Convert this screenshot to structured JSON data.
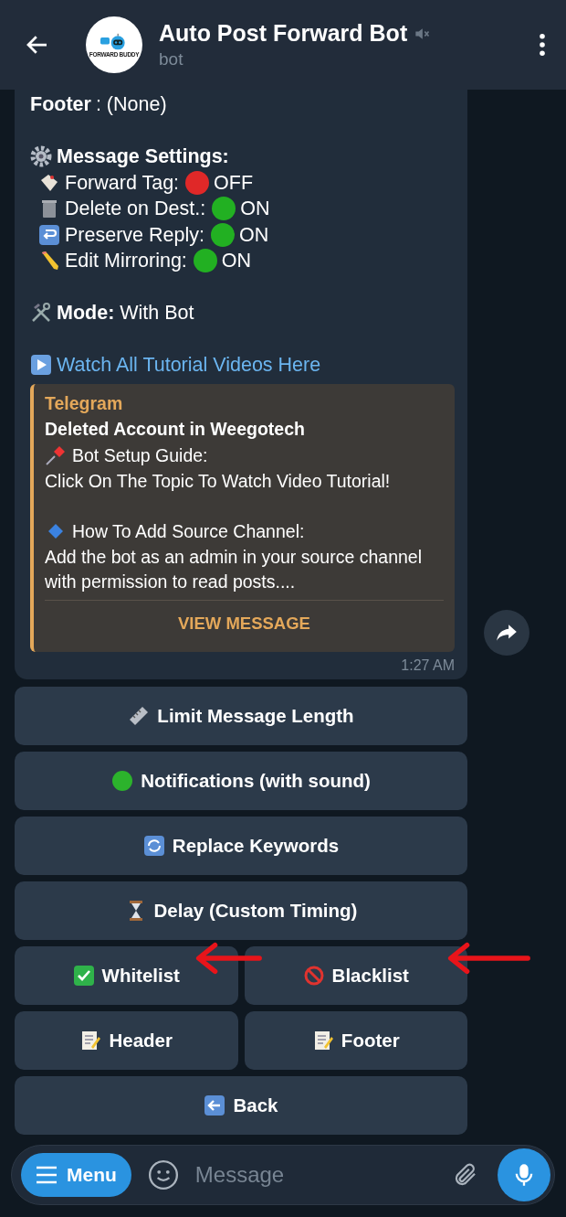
{
  "header": {
    "title": "Auto Post Forward Bot",
    "subtitle": "bot",
    "muted": true,
    "avatar_text": "FORWARD BUDDY"
  },
  "message": {
    "footer_line": "**Footer** : (None)",
    "settings_title": "Message Settings:",
    "settings": [
      {
        "kind": "tag",
        "label": "Forward Tag:",
        "on": false,
        "state": "OFF"
      },
      {
        "kind": "trash",
        "label": "Delete on Dest.:",
        "on": true,
        "state": "ON"
      },
      {
        "kind": "reply",
        "label": "Preserve Reply:",
        "on": true,
        "state": "ON"
      },
      {
        "kind": "pencil",
        "label": "Edit Mirroring:",
        "on": true,
        "state": "ON"
      }
    ],
    "mode_line": "**Mode:** With Bot",
    "link": "Watch All Tutorial Videos Here",
    "preview": {
      "source": "Telegram",
      "title": "Deleted Account in Weegotech",
      "paragraphs": [
        {
          "kind": "pin",
          "heading": "Bot Setup Guide:",
          "body": "Click On The Topic To Watch Video Tutorial!"
        },
        {
          "kind": "diamond",
          "heading": "How To Add Source Channel:",
          "body": "Add the bot as an admin in your source channel with permission to read posts...."
        }
      ],
      "action": "VIEW MESSAGE"
    },
    "time": "1:27 AM"
  },
  "keyboard": [
    [
      {
        "kind": "ruler",
        "label": "Limit Message Length"
      }
    ],
    [
      {
        "kind": "dot",
        "label": "Notifications (with sound)"
      }
    ],
    [
      {
        "kind": "refresh",
        "label": "Replace Keywords"
      }
    ],
    [
      {
        "kind": "hourglass",
        "label": "Delay (Custom Timing)"
      }
    ],
    [
      {
        "kind": "check",
        "label": "Whitelist"
      },
      {
        "kind": "prohibited",
        "label": "Blacklist"
      }
    ],
    [
      {
        "kind": "memo",
        "label": "Header"
      },
      {
        "kind": "memo",
        "label": "Footer"
      }
    ],
    [
      {
        "kind": "back",
        "label": "Back"
      }
    ]
  ],
  "composer": {
    "menu": "Menu",
    "placeholder": "Message"
  }
}
